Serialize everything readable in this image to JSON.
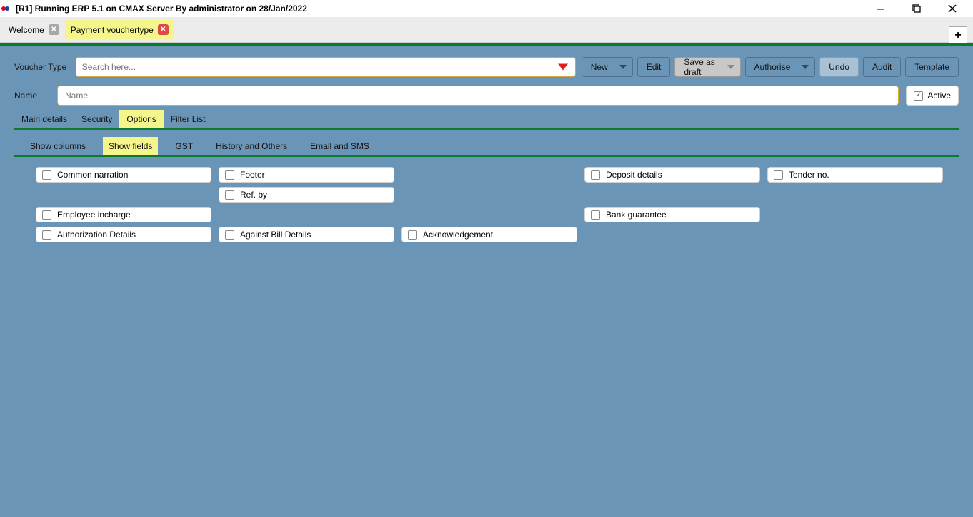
{
  "titlebar": {
    "text": "[R1] Running ERP 5.1 on CMAX Server By administrator on 28/Jan/2022"
  },
  "tabs": {
    "welcome": "Welcome",
    "payment": "Payment vouchertype"
  },
  "form": {
    "voucher_type_label": "Voucher Type",
    "search_placeholder": "Search here...",
    "name_label": "Name",
    "name_placeholder": "Name",
    "active_label": "Active"
  },
  "buttons": {
    "new": "New",
    "edit": "Edit",
    "save_draft": "Save as draft",
    "authorise": "Authorise",
    "undo": "Undo",
    "audit": "Audit",
    "template": "Template"
  },
  "main_tabs": {
    "main_details": "Main details",
    "security": "Security",
    "options": "Options",
    "filter_list": "Filter List"
  },
  "option_tabs": {
    "show_columns": "Show columns",
    "show_fields": "Show fields",
    "gst": "GST",
    "history": "History and Others",
    "email_sms": "Email and SMS"
  },
  "fields": {
    "common_narration": "Common narration",
    "footer": "Footer",
    "ref_by": "Ref. by",
    "deposit_details": "Deposit details",
    "tender_no": "Tender no.",
    "employee_incharge": "Employee incharge",
    "bank_guarantee": "Bank guarantee",
    "authorization_details": "Authorization Details",
    "against_bill": "Against Bill Details",
    "acknowledgement": "Acknowledgement"
  }
}
